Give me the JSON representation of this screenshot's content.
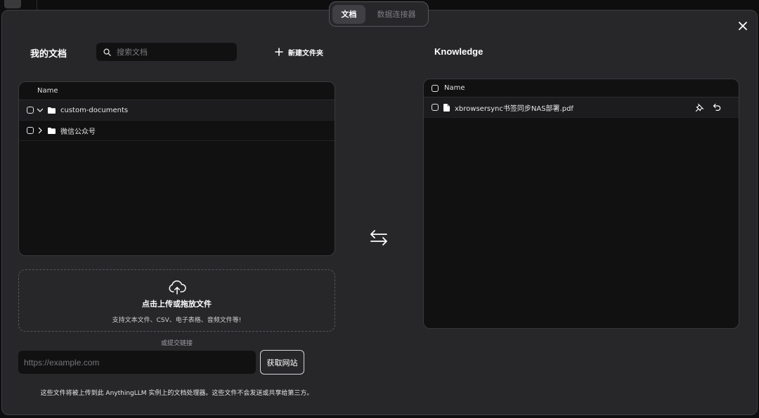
{
  "tabs": [
    {
      "label": "文档",
      "active": true
    },
    {
      "label": "数据连接器",
      "active": false
    }
  ],
  "my_documents": {
    "title": "我的文档",
    "search": {
      "placeholder": "搜索文档",
      "value": "",
      "icon": "search-icon"
    },
    "new_folder_label": "新建文件夹",
    "table": {
      "column_header": "Name",
      "rows": [
        {
          "name": "custom-documents",
          "type": "folder",
          "expanded": true
        },
        {
          "name": "微信公众号",
          "type": "folder",
          "expanded": false
        }
      ]
    },
    "upload": {
      "title": "点击上传或拖放文件",
      "subtitle": "支持文本文件、CSV、电子表格、音频文件等!",
      "icon": "cloud-upload-icon"
    },
    "link": {
      "label": "或提交链接",
      "placeholder": "https://example.com",
      "value": "",
      "button_label": "获取网站"
    },
    "footer_note": "这些文件将被上传到此 AnythingLLM 实例上的文档处理器。这些文件不会发送或共享给第三方。"
  },
  "knowledge": {
    "title": "Knowledge",
    "table": {
      "column_header": "Name",
      "rows": [
        {
          "name": "xbrowsersync书签同步NAS部署.pdf",
          "type": "file"
        }
      ]
    }
  },
  "colors": {
    "modal_bg": "#27272a",
    "panel_bg": "#111112",
    "border": "#3f3f44",
    "text": "#ffffff"
  }
}
